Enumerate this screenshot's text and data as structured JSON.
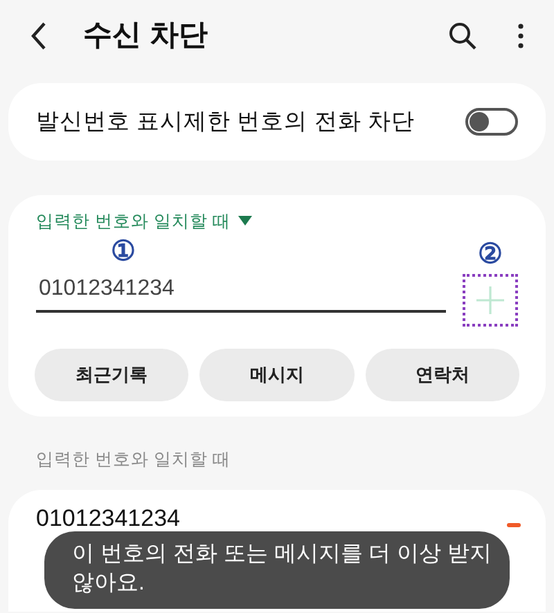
{
  "header": {
    "title": "수신 차단"
  },
  "hidden_number_block": {
    "label": "발신번호 표시제한 번호의 전화 차단",
    "on": false
  },
  "match_dropdown": {
    "label": "입력한 번호와 일치할 때"
  },
  "number_field": {
    "value": "01012341234"
  },
  "annotations": [
    "①",
    "②"
  ],
  "source_buttons": [
    "최근기록",
    "메시지",
    "연락처"
  ],
  "section_label": "입력한 번호와 일치할 때",
  "blocked_numbers": [
    {
      "number": "01012341234"
    }
  ],
  "toast": "이 번호의 전화 또는 메시지를 더 이상 받지 않아요."
}
